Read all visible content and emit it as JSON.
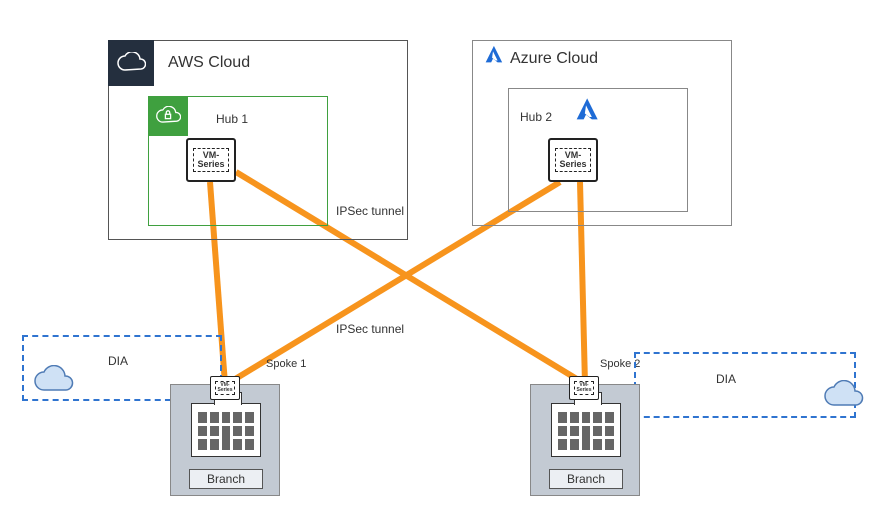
{
  "aws": {
    "title": "AWS Cloud"
  },
  "hub1": {
    "title": "Hub 1",
    "vm_label_line1": "VM-",
    "vm_label_line2": "Series"
  },
  "azure": {
    "title": "Azure Cloud"
  },
  "hub2": {
    "title": "Hub 2",
    "vm_label_line1": "VM-",
    "vm_label_line2": "Series"
  },
  "tunnels": {
    "label1": "IPSec tunnel",
    "label2": "IPSec tunnel"
  },
  "spokes": {
    "spoke1": "Spoke 1",
    "spoke2": "Spoke 2"
  },
  "dia": {
    "label1": "DIA",
    "label2": "DIA"
  },
  "branches": {
    "branch1": {
      "label": "Branch",
      "vm_label_line1": "VM-",
      "vm_label_line2": "Series"
    },
    "branch2": {
      "label": "Branch",
      "vm_label_line1": "VM-",
      "vm_label_line2": "Series"
    }
  },
  "colors": {
    "tunnel": "#f7941d",
    "dashed": "#2f74d0",
    "green": "#3fa03f",
    "awsdark": "#242f3e"
  },
  "topology": {
    "hubs": [
      "Hub 1 (AWS)",
      "Hub 2 (Azure)"
    ],
    "spokes": [
      "Spoke 1 / Branch",
      "Spoke 2 / Branch"
    ],
    "links": [
      {
        "from": "Hub 1",
        "to": "Spoke 1",
        "type": "IPSec"
      },
      {
        "from": "Hub 1",
        "to": "Spoke 2",
        "type": "IPSec"
      },
      {
        "from": "Hub 2",
        "to": "Spoke 1",
        "type": "IPSec"
      },
      {
        "from": "Hub 2",
        "to": "Spoke 2",
        "type": "IPSec"
      },
      {
        "from": "Spoke 1",
        "to": "Internet",
        "type": "DIA"
      },
      {
        "from": "Spoke 2",
        "to": "Internet",
        "type": "DIA"
      }
    ]
  }
}
